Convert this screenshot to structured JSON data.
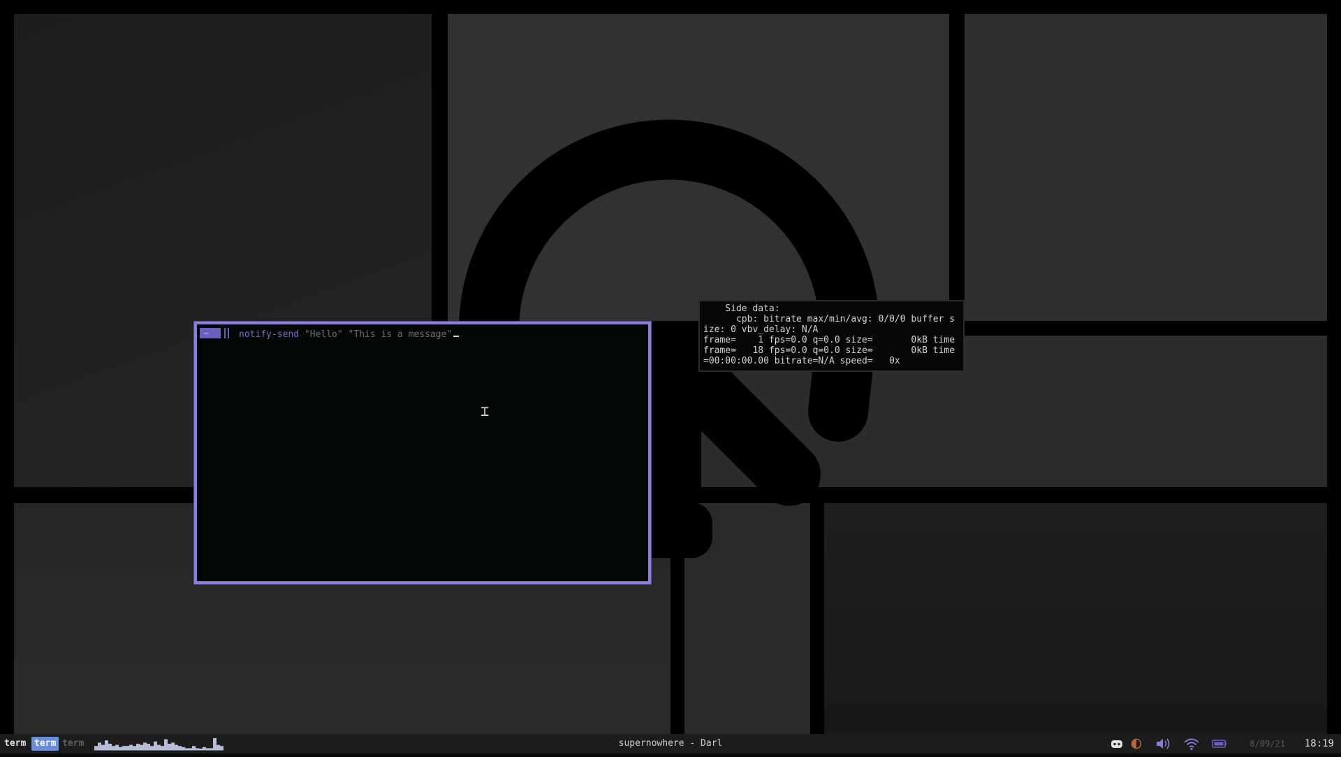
{
  "terminal": {
    "prompt_symbol": "~",
    "command": "notify-send",
    "arg1": "\"Hello\"",
    "arg2": "\"This is a message\""
  },
  "ffmpeg_output": {
    "lines": [
      "    Side data:",
      "      cpb: bitrate max/min/avg: 0/0/0 buffer s",
      "ize: 0 vbv_delay: N/A",
      "frame=    1 fps=0.0 q=0.0 size=       0kB time",
      "frame=   18 fps=0.0 q=0.0 size=       0kB time",
      "=00:00:00.00 bitrate=N/A speed=   0x"
    ]
  },
  "statusbar": {
    "workspaces": [
      "term",
      "term",
      "term"
    ],
    "active_workspace": 2,
    "window_title": "supernowhere - Darl",
    "date": "8/09/21",
    "time": "18:19",
    "tray_icons": [
      "discord-icon",
      "night-light-icon",
      "volume-icon",
      "wifi-icon",
      "battery-icon"
    ],
    "cpu_history": [
      3,
      6,
      4,
      8,
      5,
      3,
      4,
      2,
      3,
      3,
      4,
      3,
      5,
      4,
      6,
      5,
      3,
      7,
      4,
      3,
      9,
      5,
      6,
      4,
      3,
      2,
      1,
      1,
      3,
      1,
      0,
      2,
      1,
      1,
      10,
      4,
      3
    ]
  },
  "colors": {
    "accent": "#8a7fd4",
    "workspace_active": "#6a8fd8",
    "terminal_bg": "#020605"
  }
}
